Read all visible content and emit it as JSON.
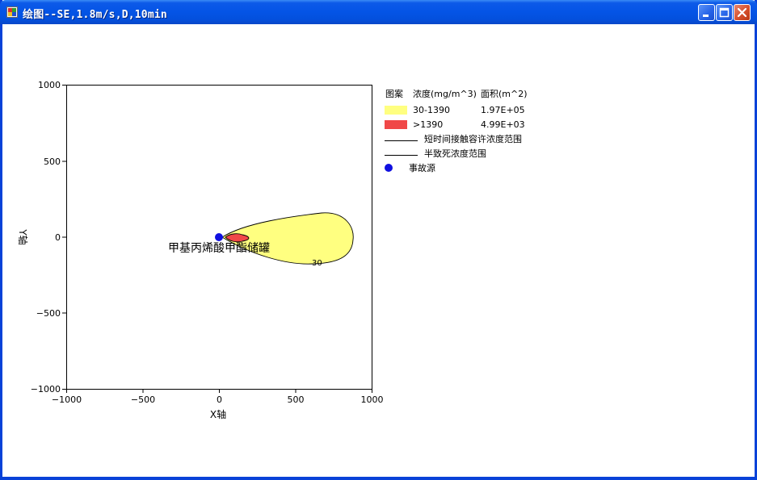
{
  "window": {
    "title": "绘图--SE,1.8m/s,D,10min"
  },
  "plot": {
    "x_axis_label": "X轴",
    "y_axis_label": "Y轴",
    "x_ticks": [
      "−1000",
      "−500",
      "0",
      "500",
      "1000"
    ],
    "y_ticks": [
      "1000",
      "500",
      "0",
      "−500",
      "−1000"
    ],
    "x_range": [
      -1000,
      1000
    ],
    "y_range": [
      -1000,
      1000
    ],
    "source_label": "甲基丙烯酸甲酯储罐",
    "contour_label": "30",
    "colors": {
      "low_band": "#ffff80",
      "high_band": "#f04848",
      "source": "#1010e0"
    }
  },
  "legend": {
    "header": {
      "pattern": "图案",
      "concentration": "浓度(mg/m^3)",
      "area": "面积(m^2)"
    },
    "rows": [
      {
        "range": "30-1390",
        "area": "1.97E+05"
      },
      {
        "range": ">1390",
        "area": "4.99E+03"
      }
    ],
    "line_items": [
      "短时间接触容许浓度范围",
      "半致死浓度范围"
    ],
    "source_item": "事故源"
  }
}
